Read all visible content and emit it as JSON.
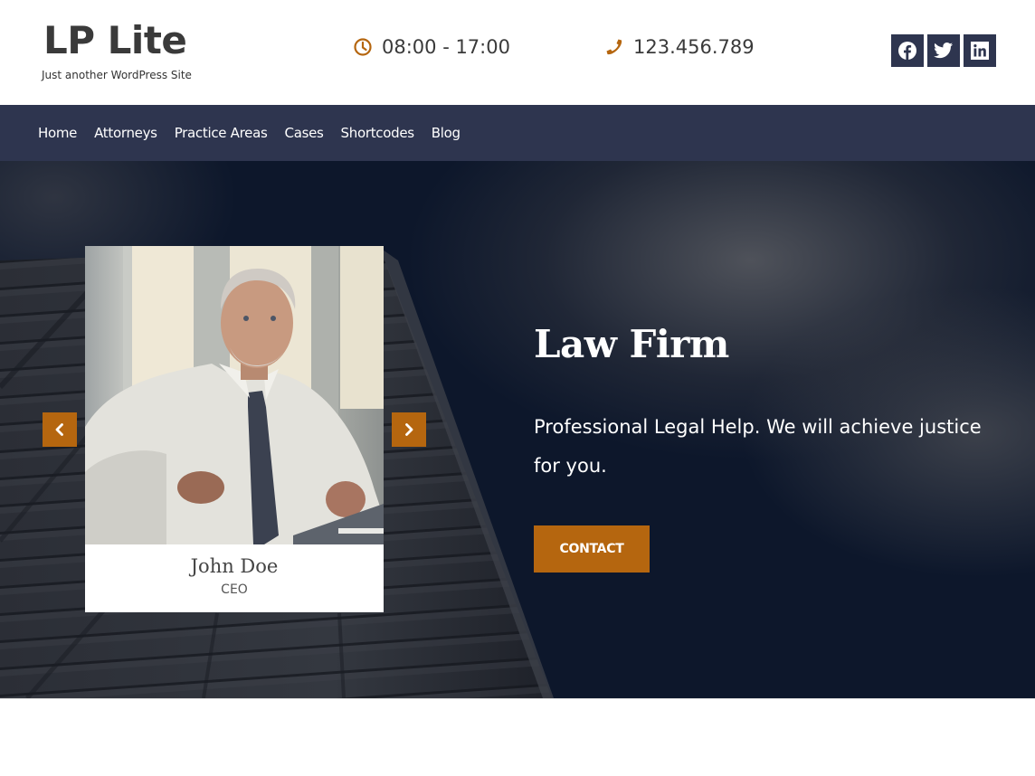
{
  "header": {
    "site_title": "LP Lite",
    "tagline": "Just another WordPress Site",
    "hours": {
      "icon": "clock-icon",
      "text": "08:00 - 17:00"
    },
    "phone": {
      "icon": "phone-icon",
      "text": "123.456.789"
    },
    "social": [
      {
        "name": "facebook",
        "icon": "facebook-icon"
      },
      {
        "name": "twitter",
        "icon": "twitter-icon"
      },
      {
        "name": "linkedin",
        "icon": "linkedin-icon"
      }
    ]
  },
  "nav": {
    "items": [
      {
        "label": "Home"
      },
      {
        "label": "Attorneys"
      },
      {
        "label": "Practice Areas"
      },
      {
        "label": "Cases"
      },
      {
        "label": "Shortcodes"
      },
      {
        "label": "Blog"
      }
    ]
  },
  "hero": {
    "slide": {
      "name": "John Doe",
      "role": "CEO",
      "prev_icon": "chevron-left-icon",
      "next_icon": "chevron-right-icon"
    },
    "title": "Law Firm",
    "subtitle": "Professional Legal Help. We will achieve justice for you.",
    "cta_label": "CONTACT"
  },
  "colors": {
    "accent": "#b5660f",
    "nav_bg": "#2e354f",
    "hero_bg": "#0d172b",
    "text_dark": "#3a3a3a"
  }
}
